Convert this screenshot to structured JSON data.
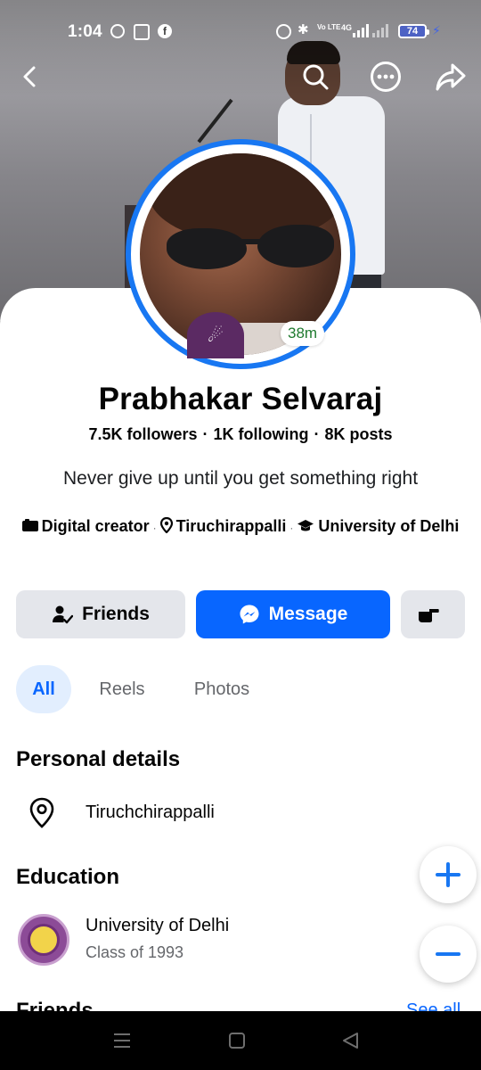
{
  "status_bar": {
    "time": "1:04",
    "volte": "Vo LTE",
    "network": "4G",
    "battery": "74"
  },
  "icons": {
    "back": "arrow-left-icon",
    "search": "search-icon",
    "more": "more-horizontal-icon",
    "share": "share-icon"
  },
  "profile": {
    "name": "Prabhakar Selvaraj",
    "followers": "7.5K followers",
    "following": "1K following",
    "posts": "8K posts",
    "bio": "Never give up until you get something right",
    "story_age": "38m",
    "meta": {
      "category": "Digital creator",
      "location": "Tiruchirappalli",
      "education": "University of Delhi"
    }
  },
  "actions": {
    "friends": "Friends",
    "message": "Message"
  },
  "tabs": [
    "All",
    "Reels",
    "Photos"
  ],
  "personal_details": {
    "title": "Personal details",
    "location": "Tiruchchirappalli"
  },
  "education": {
    "title": "Education",
    "school": "University of Delhi",
    "class": "Class of 1993"
  },
  "friends_section": {
    "title": "Friends",
    "see_all": "See all"
  },
  "colors": {
    "accent": "#0866ff",
    "story_ring": "#1877f2",
    "button_gray": "#e4e6eb",
    "story_text": "#1f7a2f"
  }
}
